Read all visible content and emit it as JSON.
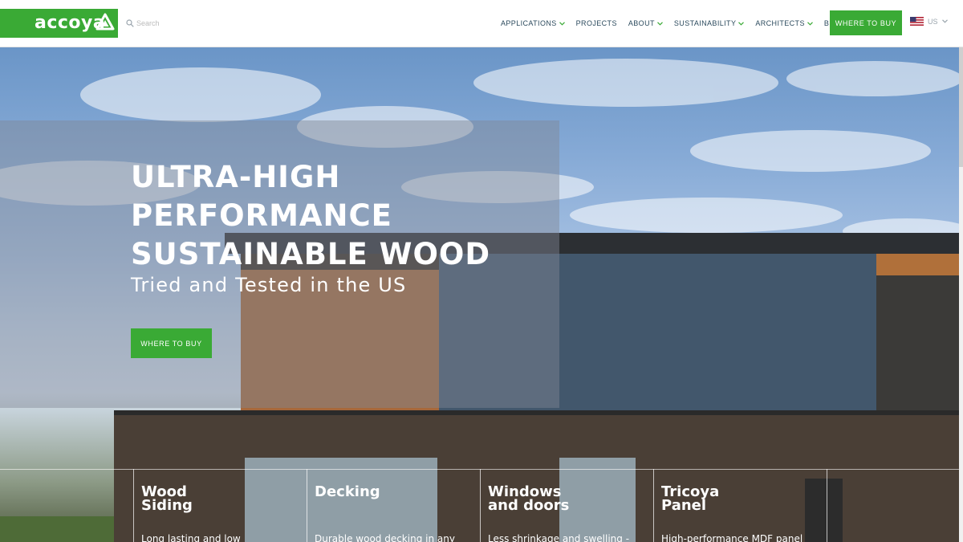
{
  "header": {
    "logo_text": "accoya",
    "search_placeholder": "Search",
    "nav": [
      {
        "label": "APPLICATIONS",
        "has_dropdown": true
      },
      {
        "label": "PROJECTS",
        "has_dropdown": false
      },
      {
        "label": "ABOUT",
        "has_dropdown": true
      },
      {
        "label": "SUSTAINABILITY",
        "has_dropdown": true
      },
      {
        "label": "ARCHITECTS",
        "has_dropdown": true
      },
      {
        "label": "BLOG",
        "has_dropdown": false
      }
    ],
    "where_to_buy_label": "WHERE TO BUY",
    "locale_label": "US"
  },
  "hero": {
    "title_lines": [
      "ULTRA-HIGH",
      "PERFORMANCE",
      "SUSTAINABLE WOOD"
    ],
    "subtitle": "Tried and Tested in the US",
    "button_label": "WHERE TO BUY"
  },
  "cards": [
    {
      "title": "Wood Siding",
      "description": "Long lasting and low"
    },
    {
      "title": "Decking",
      "description": "Durable wood decking in any"
    },
    {
      "title": "Windows and doors",
      "description": "Less shrinkage and swelling -"
    },
    {
      "title": "Tricoya Panel",
      "description": "High-performance MDF panel"
    }
  ],
  "colors": {
    "brand_green": "#3aaa35",
    "nav_text": "#2b4a5d",
    "header_bg": "#ffffff"
  },
  "icons": {
    "logo": "accoya-triangle-logo-icon",
    "search": "search-icon",
    "dropdown": "chevron-down-icon",
    "flag": "us-flag-icon",
    "locale_dropdown": "chevron-down-icon"
  }
}
